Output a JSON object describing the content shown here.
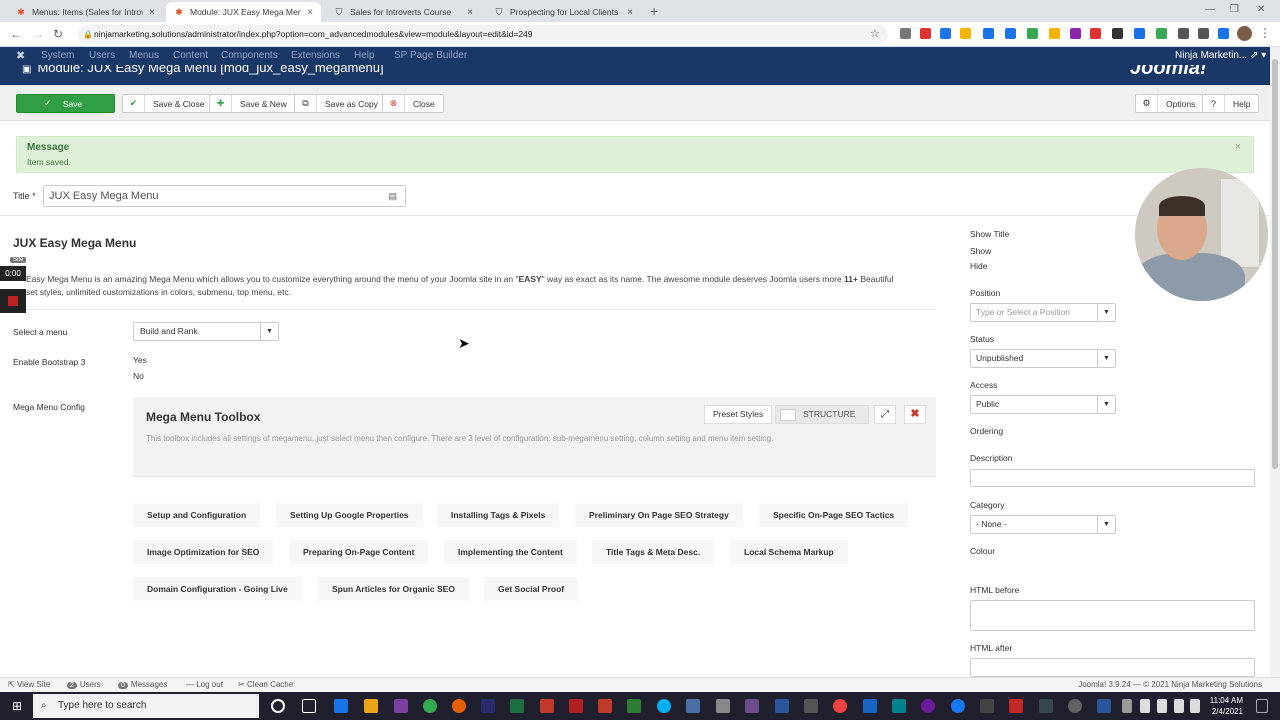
{
  "browser": {
    "tabs": [
      {
        "label": "Menus: Items (Sales for Introverts",
        "active": false,
        "icon": "joomla-icon"
      },
      {
        "label": "Module: JUX Easy Mega Menu [m",
        "active": true,
        "icon": "joomla-icon"
      },
      {
        "label": "Sales for Introverts Course",
        "active": false,
        "icon": "shield-icon"
      },
      {
        "label": "Prospecting for Local Clients",
        "active": false,
        "icon": "shield-icon"
      }
    ],
    "url": "ninjamarketing.solutions/administrator/index.php?option=com_advancedmodules&view=module&layout=edit&id=249"
  },
  "joomla_nav": {
    "items": [
      "System",
      "Users",
      "Menus",
      "Content",
      "Components",
      "Extensions",
      "Help",
      "SP Page Builder"
    ],
    "user": "Ninja Marketin..."
  },
  "header": {
    "title": "Module: JUX Easy Mega Menu [mod_jux_easy_megamenu]",
    "brand": "Joomla!"
  },
  "toolbar": {
    "save": "Save",
    "save_close": "Save & Close",
    "save_new": "Save & New",
    "save_copy": "Save as Copy",
    "close": "Close",
    "options": "Options",
    "help": "Help"
  },
  "message": {
    "heading": "Message",
    "text": "Item saved."
  },
  "form": {
    "title_label": "Title *",
    "title_value": "JUX Easy Mega Menu",
    "module_heading": "JUX Easy Mega Menu",
    "desc_part1": "Easy Mega Menu is an amazing Mega Menu which allows you to customize everything around the menu of your Joomla site in an \"",
    "desc_easy": "EASY",
    "desc_part2": "\" way as exact as its name. The awesome module deserves Joomla users more ",
    "desc_count": "11+",
    "desc_part3": " Beautiful",
    "desc_line2": "set styles, unlimited customizations in colors, submenu, top menu, etc.",
    "select_menu_label": "Select a menu",
    "select_menu_value": "Build and Rank",
    "bootstrap_label": "Enable Bootstrap 3",
    "bootstrap_yes": "Yes",
    "bootstrap_no": "No",
    "megamenu_config_label": "Mega Menu Config"
  },
  "overlay": {
    "site_badge": "Site",
    "timer": "0:00"
  },
  "toolbox": {
    "title": "Mega Menu Toolbox",
    "desc": "This toolbox includes all settings of megamenu, just select menu then configure. There are 3 level of configuration: sub-megamenu setting, column setting and menu item setting.",
    "preset": "Preset Styles",
    "structure": "STRUCTURE"
  },
  "menu_items": [
    "Setup and Configuration",
    "Setting Up Google Properties",
    "Installing Tags & Pixels",
    "Preliminary On Page SEO Strategy",
    "Specific On-Page SEO Tactics",
    "Image Optimization for SEO",
    "Preparing On-Page Content",
    "Implementing the Content",
    "Title Tags & Meta Desc.",
    "Local Schema Markup",
    "Domain Configuration - Going Live",
    "Spun Articles for Organic SEO",
    "Get Social Proof"
  ],
  "sidebar": {
    "show_title_label": "Show Title",
    "show": "Show",
    "hide": "Hide",
    "position_label": "Position",
    "position_placeholder": "Type or Select a Position",
    "status_label": "Status",
    "status_value": "Unpublished",
    "access_label": "Access",
    "access_value": "Public",
    "ordering_label": "Ordering",
    "description_label": "Description",
    "category_label": "Category",
    "category_value": "- None -",
    "colour_label": "Colour",
    "html_before_label": "HTML before",
    "html_after_label": "HTML after"
  },
  "statusbar": {
    "view_site": "View Site",
    "users_count": "2",
    "users": "Users",
    "messages_count": "0",
    "messages": "Messages",
    "logout": "Log out",
    "clean_cache": "Clean Cache",
    "version": "Joomla! 3.9.24 — © 2021 Ninja Marketing Solutions"
  },
  "taskbar": {
    "search_placeholder": "Type here to search",
    "time": "11:04 AM",
    "date": "2/4/2021"
  },
  "colors": {
    "save_green": "#2f9e44",
    "joomla_navy": "#1a3867",
    "message_bg": "#dff0d8"
  }
}
